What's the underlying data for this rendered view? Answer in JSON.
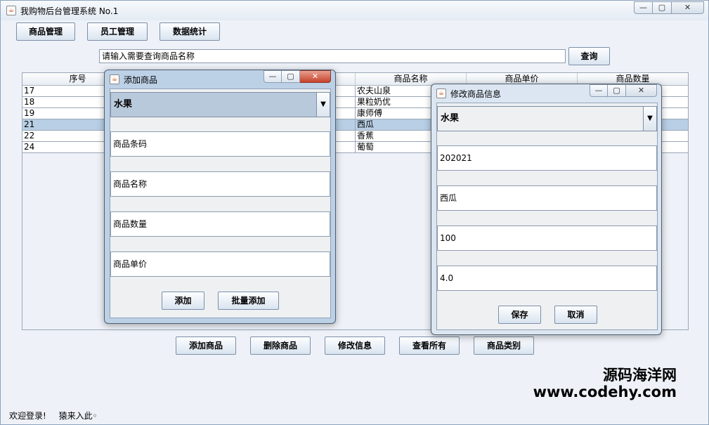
{
  "window": {
    "title": "我购物后台管理系统 No.1",
    "min": "—",
    "max": "▢",
    "close": "✕"
  },
  "nav": {
    "goods": "商品管理",
    "staff": "员工管理",
    "stats": "数据统计"
  },
  "search": {
    "value": "请输入需要查询商品名称",
    "button": "查询"
  },
  "table": {
    "headers": [
      "序号",
      "",
      "",
      "商品名称",
      "商品单价",
      "商品数量"
    ],
    "rows": [
      {
        "id": "17",
        "name": "农夫山泉",
        "selected": false
      },
      {
        "id": "18",
        "name": "果粒奶优",
        "selected": false
      },
      {
        "id": "19",
        "name": "康师傅",
        "selected": false
      },
      {
        "id": "21",
        "name": "西瓜",
        "selected": true
      },
      {
        "id": "22",
        "name": "香蕉",
        "selected": false
      },
      {
        "id": "24",
        "name": "葡萄",
        "selected": false
      }
    ]
  },
  "actions": {
    "add": "添加商品",
    "delete": "删除商品",
    "edit": "修改信息",
    "view_all": "查看所有",
    "category": "商品类别"
  },
  "footer": {
    "welcome": "欢迎登录!",
    "user": "猿来入此◦"
  },
  "watermark": {
    "name": "源码海洋网",
    "url": "www.codehy.com"
  },
  "add_dialog": {
    "title": "添加商品",
    "category": "水果",
    "barcode_placeholder": "商品条码",
    "name_placeholder": "商品名称",
    "quantity_placeholder": "商品数量",
    "price_placeholder": "商品单价",
    "add_button": "添加",
    "batch_button": "批量添加"
  },
  "edit_dialog": {
    "title": "修改商品信息",
    "category": "水果",
    "barcode": "202021",
    "name": "西瓜",
    "quantity": "100",
    "price": "4.0",
    "save_button": "保存",
    "cancel_button": "取消"
  }
}
